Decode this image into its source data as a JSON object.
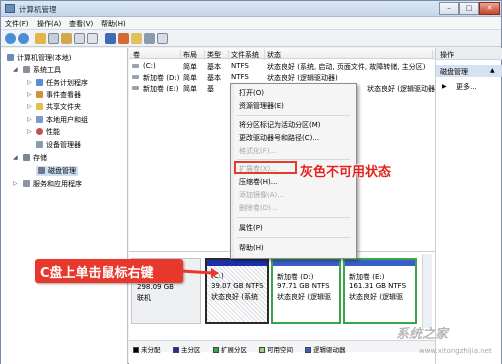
{
  "window": {
    "title": "计算机管理"
  },
  "menubar": [
    "文件(F)",
    "操作(A)",
    "查看(V)",
    "帮助(H)"
  ],
  "tree": {
    "root": "计算机管理(本地)",
    "system_tools": "系统工具",
    "task_scheduler": "任务计划程序",
    "event_viewer": "事件查看器",
    "shared_folders": "共享文件夹",
    "local_users": "本地用户和组",
    "performance": "性能",
    "device_manager": "设备管理器",
    "storage": "存储",
    "disk_management": "磁盘管理",
    "services_apps": "服务和应用程序"
  },
  "volume_list": {
    "headers": [
      "卷",
      "布局",
      "类型",
      "文件系统",
      "状态"
    ],
    "rows": [
      [
        "(C:)",
        "简单",
        "基本",
        "NTFS",
        "状态良好 (系统, 启动, 页面文件, 故障转储, 主分区)"
      ],
      [
        "新加卷 (D:)",
        "简单",
        "基本",
        "NTFS",
        "状态良好 (逻辑驱动器)"
      ],
      [
        "新加卷 (E:)",
        "简单",
        "基",
        "",
        "状态良好 (逻辑驱动器)"
      ]
    ]
  },
  "actions": {
    "header": "操作",
    "section": "磁盘管理",
    "more": "更多..."
  },
  "context_menu": {
    "items": [
      {
        "label": "打开(O)",
        "enabled": true
      },
      {
        "label": "资源管理器(E)",
        "enabled": true
      },
      {
        "label": "将分区标记为活动分区(M)",
        "enabled": true
      },
      {
        "label": "更改驱动器号和路径(C)...",
        "enabled": true
      },
      {
        "label": "格式化(F)...",
        "enabled": false
      },
      {
        "label": "扩展卷(X)...",
        "enabled": false
      },
      {
        "label": "压缩卷(H)...",
        "enabled": true
      },
      {
        "label": "添加镜像(A)...",
        "enabled": false
      },
      {
        "label": "删除卷(D)...",
        "enabled": false
      },
      {
        "label": "属性(P)",
        "enabled": true
      },
      {
        "label": "帮助(H)",
        "enabled": true
      }
    ]
  },
  "disk": {
    "size": "298.09 GB",
    "status": "联机",
    "partitions": [
      {
        "name": "(C:)",
        "size": "39.07 GB NTFS",
        "status": "状态良好 (系统"
      },
      {
        "name": "新加卷 (D:)",
        "size": "97.71 GB NTFS",
        "status": "状态良好 (逻辑驱"
      },
      {
        "name": "新加卷 (E:)",
        "size": "161.31 GB NTFS",
        "status": "状态良好 (逻辑驱"
      }
    ]
  },
  "legend": [
    {
      "label": "未分配",
      "color": "#000000"
    },
    {
      "label": "主分区",
      "color": "#1c2fa8"
    },
    {
      "label": "扩展分区",
      "color": "#3aa64a"
    },
    {
      "label": "可用空间",
      "color": "#9ad27a"
    },
    {
      "label": "逻辑驱动器",
      "color": "#3a5ec8"
    }
  ],
  "callouts": {
    "gray_unavailable": "灰色不可用状态",
    "right_click_c": "C盘上单击鼠标右键"
  },
  "watermark": {
    "brand": "系统之家",
    "url": "www.xitongzhijia.net"
  }
}
